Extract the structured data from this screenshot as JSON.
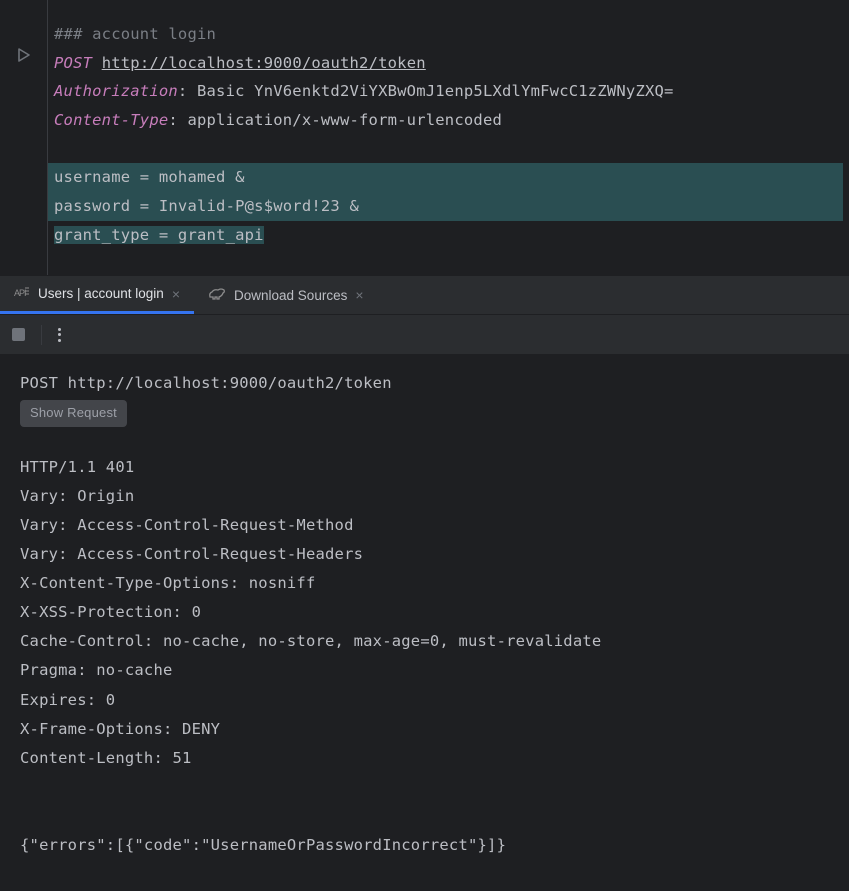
{
  "editor": {
    "comment": "### account login",
    "method": "POST",
    "url": "http://localhost:9000/oauth2/token",
    "headers": {
      "auth_name": "Authorization",
      "auth_value": ": Basic YnV6enktd2ViYXBwOmJ1enp5LXdlYmFwcC1zZWNyZXQ=",
      "ct_name": "Content-Type",
      "ct_value": ": application/x-www-form-urlencoded"
    },
    "body": {
      "line1": "username = mohamed &",
      "line2": "password = Invalid-P@s$word!23 &",
      "line3": "grant_type = grant_api"
    }
  },
  "tabs": {
    "t1": "Users | account login",
    "t2": "Download Sources"
  },
  "response": {
    "request_line": "POST http://localhost:9000/oauth2/token",
    "show_request": "Show Request",
    "headers": [
      "HTTP/1.1 401",
      "Vary: Origin",
      "Vary: Access-Control-Request-Method",
      "Vary: Access-Control-Request-Headers",
      "X-Content-Type-Options: nosniff",
      "X-XSS-Protection: 0",
      "Cache-Control: no-cache, no-store, max-age=0, must-revalidate",
      "Pragma: no-cache",
      "Expires: 0",
      "X-Frame-Options: DENY",
      "Content-Length: 51"
    ],
    "body": "{\"errors\":[{\"code\":\"UsernameOrPasswordIncorrect\"}]}"
  }
}
